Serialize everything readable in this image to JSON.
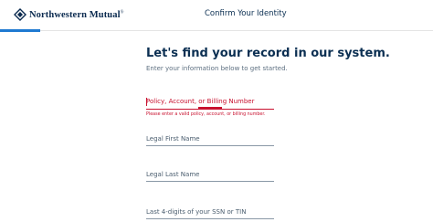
{
  "header": {
    "brand_name": "Northwestern Mutual",
    "brand_trademark": "®",
    "title": "Confirm Your Identity"
  },
  "main": {
    "heading": "Let's find your record in our system.",
    "subheading": "Enter your information below to get started."
  },
  "form": {
    "policy_field": {
      "label": "Policy, Account, or Billing Number",
      "value": "",
      "error": "Please enter a valid policy, account, or billing number."
    },
    "first_name_field": {
      "label": "Legal First Name",
      "value": ""
    },
    "last_name_field": {
      "label": "Legal Last Name",
      "value": ""
    },
    "ssn_field": {
      "label": "Last 4-digits of your SSN or TIN",
      "value": ""
    }
  },
  "colors": {
    "brand_navy": "#0b2f52",
    "accent_blue": "#1f7ad1",
    "error_red": "#c8102e"
  },
  "icons": {
    "logo": "northwestern-mutual-logo-icon"
  }
}
